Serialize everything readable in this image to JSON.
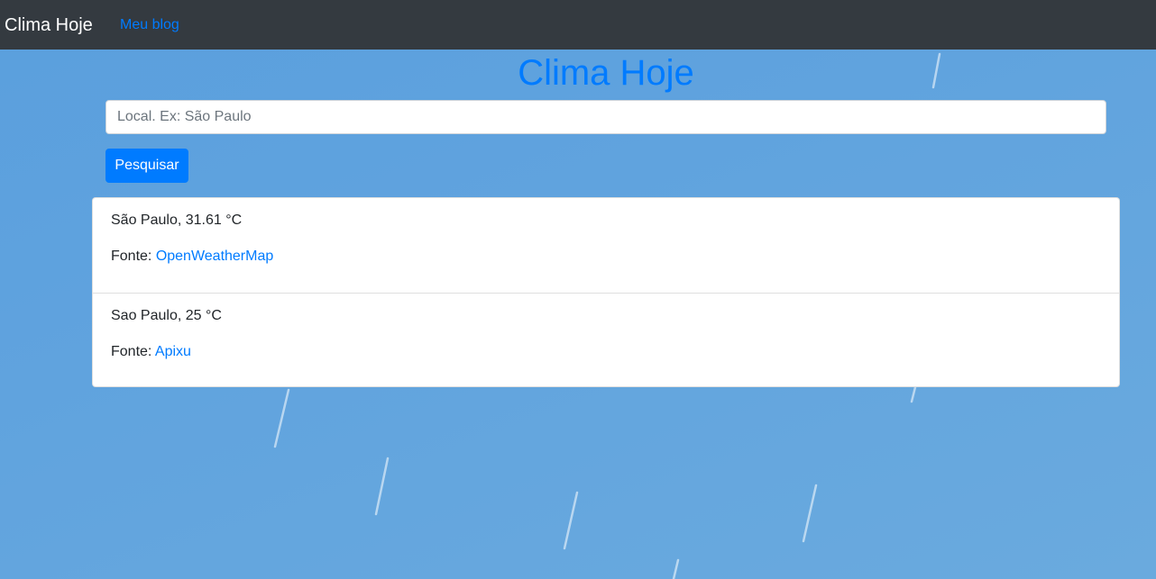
{
  "navbar": {
    "brand": "Clima Hoje",
    "link": "Meu blog"
  },
  "page": {
    "title": "Clima Hoje"
  },
  "search": {
    "placeholder": "Local. Ex: São Paulo",
    "value": "",
    "button_label": "Pesquisar"
  },
  "results": [
    {
      "summary": "São Paulo, 31.61 °C",
      "source_label": "Fonte:",
      "source_name": "OpenWeatherMap"
    },
    {
      "summary": "Sao Paulo, 25 °C",
      "source_label": "Fonte:",
      "source_name": "Apixu"
    }
  ],
  "colors": {
    "navbar_bg": "#343a40",
    "accent": "#007bff",
    "background": "#5ea2de"
  }
}
